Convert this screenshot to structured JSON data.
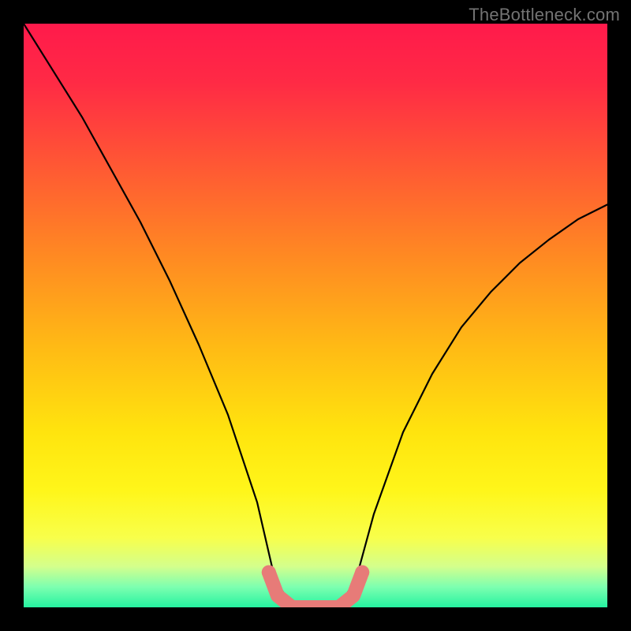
{
  "watermark": "TheBottleneck.com",
  "chart_data": {
    "type": "line",
    "title": "",
    "xlabel": "",
    "ylabel": "",
    "xlim": [
      0,
      100
    ],
    "ylim": [
      0,
      100
    ],
    "series": [
      {
        "name": "bottleneck-curve",
        "x": [
          0,
          5,
          10,
          15,
          20,
          25,
          30,
          35,
          40,
          43,
          46,
          50,
          54,
          57,
          60,
          65,
          70,
          75,
          80,
          85,
          90,
          95,
          100
        ],
        "values": [
          100,
          92,
          84,
          75,
          66,
          56,
          45,
          33,
          18,
          5,
          0,
          0,
          0,
          5,
          16,
          30,
          40,
          48,
          54,
          59,
          63,
          66.5,
          69
        ]
      }
    ],
    "highlight": {
      "name": "bottleneck-flat-region",
      "x": [
        42,
        43.5,
        46,
        50,
        54,
        56.5,
        58
      ],
      "values": [
        6,
        2,
        0,
        0,
        0,
        2,
        6
      ]
    },
    "gradient_stops": [
      {
        "offset": 0.0,
        "color": "#ff1a4b"
      },
      {
        "offset": 0.1,
        "color": "#ff2a45"
      },
      {
        "offset": 0.25,
        "color": "#ff5a33"
      },
      {
        "offset": 0.4,
        "color": "#ff8a22"
      },
      {
        "offset": 0.55,
        "color": "#ffb915"
      },
      {
        "offset": 0.7,
        "color": "#ffe40e"
      },
      {
        "offset": 0.8,
        "color": "#fff61a"
      },
      {
        "offset": 0.88,
        "color": "#f8ff4a"
      },
      {
        "offset": 0.93,
        "color": "#d4ff8c"
      },
      {
        "offset": 0.965,
        "color": "#7dffb0"
      },
      {
        "offset": 1.0,
        "color": "#25f3a0"
      }
    ]
  }
}
